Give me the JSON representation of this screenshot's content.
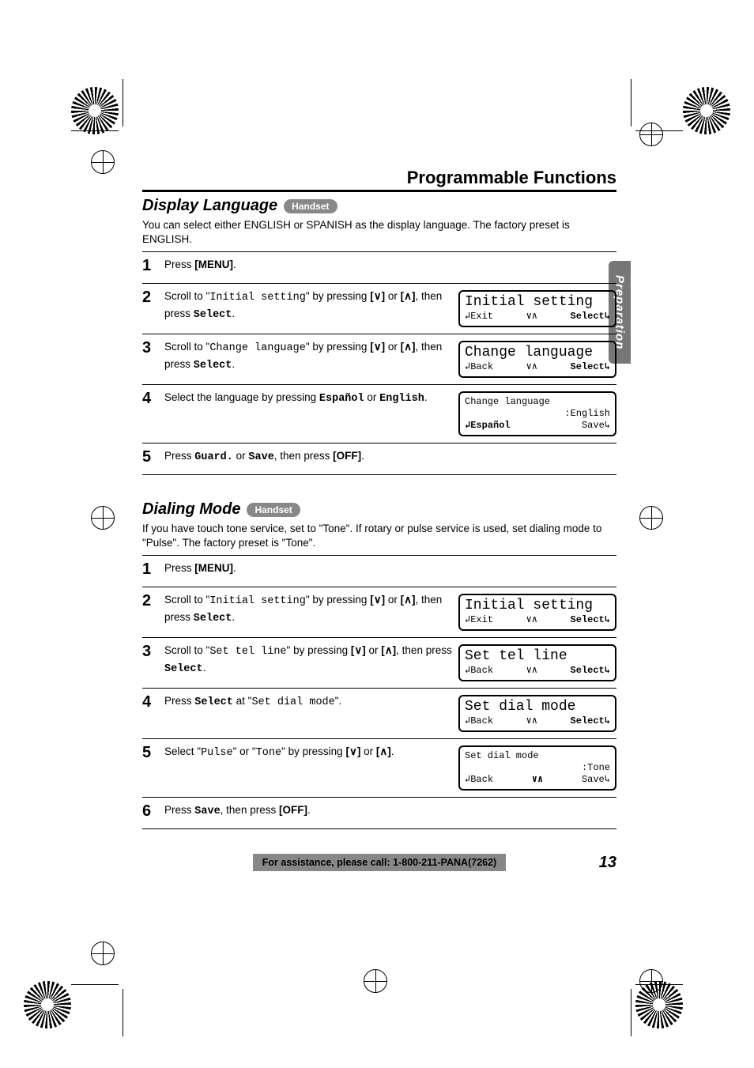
{
  "header": {
    "title": "Programmable Functions"
  },
  "side_tab": "Preparation",
  "section1": {
    "title": "Display Language",
    "pill": "Handset",
    "intro": "You can select either ENGLISH or SPANISH as the display language. The factory preset is ENGLISH.",
    "steps": [
      {
        "num": "1",
        "plain_pre": "Press ",
        "bold1": "[MENU]",
        "plain_post": "."
      },
      {
        "num": "2",
        "t1": "Scroll to \"",
        "m1": "Initial setting",
        "t2": "\" by pressing ",
        "b1": "[",
        "t3": " or ",
        "b2": "[",
        "t4": ", then press ",
        "bm1": "Select",
        "t5": ".",
        "lcd": {
          "l1": "Initial setting",
          "l2_left": "↲Exit",
          "l2_mid": "∨∧",
          "l2_right": "Select↳"
        }
      },
      {
        "num": "3",
        "t1": "Scroll to \"",
        "m1": "Change language",
        "t2": "\" by pressing ",
        "b1": "[",
        "t3": " or ",
        "b2": "[",
        "t4": ", then press ",
        "bm1": "Select",
        "t5": ".",
        "lcd": {
          "l1": "Change language",
          "l2_left": "↲Back",
          "l2_mid": "∨∧",
          "l2_right": "Select↳"
        }
      },
      {
        "num": "4",
        "t1": "Select the language by pressing ",
        "bm1": "Español",
        "t2": " or ",
        "bm2": "English",
        "t3": ".",
        "lcd": {
          "l1": "Change language",
          "l2": ":English",
          "l3_left": "↲Español",
          "l3_right": "Save↳"
        }
      },
      {
        "num": "5",
        "t1": "Press ",
        "bm1": "Guard.",
        "t2": " or ",
        "bm2": "Save",
        "t3": ", then press ",
        "b1": "[OFF]",
        "t4": "."
      }
    ]
  },
  "section2": {
    "title": "Dialing Mode",
    "pill": "Handset",
    "intro": "If you have touch tone service, set to \"Tone\". If rotary or pulse service is used, set dialing mode to \"Pulse\". The factory preset is \"Tone\".",
    "steps": [
      {
        "num": "1",
        "plain_pre": "Press ",
        "bold1": "[MENU]",
        "plain_post": "."
      },
      {
        "num": "2",
        "t1": "Scroll to \"",
        "m1": "Initial setting",
        "t2": "\" by pressing ",
        "b1": "[",
        "t3": " or ",
        "b2": "[",
        "t4": ", then press ",
        "bm1": "Select",
        "t5": ".",
        "lcd": {
          "l1": "Initial setting",
          "l2_left": "↲Exit",
          "l2_mid": "∨∧",
          "l2_right": "Select↳"
        }
      },
      {
        "num": "3",
        "t1": "Scroll to \"",
        "m1": "Set tel line",
        "t2": "\" by pressing ",
        "b1": "[",
        "t3": " or ",
        "b2": "[",
        "t4": ", then press ",
        "bm1": "Select",
        "t5": ".",
        "lcd": {
          "l1": "Set tel line",
          "l2_left": "↲Back",
          "l2_mid": "∨∧",
          "l2_right": "Select↳"
        }
      },
      {
        "num": "4",
        "t1": "Press ",
        "bm1": "Select",
        "t2": " at \"",
        "m1": "Set dial mode",
        "t3": "\".",
        "lcd": {
          "l1": "Set dial mode",
          "l2_left": "↲Back",
          "l2_mid": "∨∧",
          "l2_right": "Select↳"
        }
      },
      {
        "num": "5",
        "t1": "Select \"",
        "m1": "Pulse",
        "t2": "\" or \"",
        "m2": "Tone",
        "t3": "\" by pressing ",
        "b1": "[",
        "t4": " or ",
        "b2": "[",
        "t5": ".",
        "lcd": {
          "l1": "Set dial mode",
          "l2": ":Tone",
          "l3_left": "↲Back",
          "l3_mid": "∨∧",
          "l3_right": "Save↳"
        }
      },
      {
        "num": "6",
        "t1": "Press ",
        "bm1": "Save",
        "t2": ", then press ",
        "b1": "[OFF]",
        "t3": "."
      }
    ]
  },
  "footer": {
    "assist": "For assistance, please call: 1-800-211-PANA(7262)",
    "page": "13"
  },
  "glyphs": {
    "down": "∨",
    "up": "∧"
  }
}
